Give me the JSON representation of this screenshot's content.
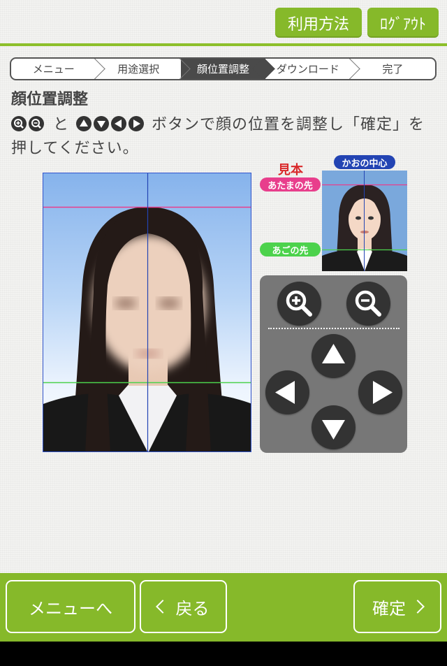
{
  "header": {
    "howto_label": "利用方法",
    "logout_label": "ﾛｸﾞｱｳﾄ"
  },
  "steps": [
    {
      "label": "メニュー",
      "active": false
    },
    {
      "label": "用途選択",
      "active": false
    },
    {
      "label": "顔位置調整",
      "active": true
    },
    {
      "label": "ダウンロード",
      "active": false
    },
    {
      "label": "完了",
      "active": false
    }
  ],
  "page": {
    "title": "顔位置調整",
    "instruction_and": "と",
    "instruction_rest": "ボタンで顔の位置を調整し「確定」を押してください。"
  },
  "sample": {
    "title": "見本",
    "center_label": "かおの中心",
    "head_label": "あたまの先",
    "chin_label": "あごの先"
  },
  "controls": {
    "zoom_in": "zoom-in-icon",
    "zoom_out": "zoom-out-icon",
    "up": "arrow-up-icon",
    "down": "arrow-down-icon",
    "left": "arrow-left-icon",
    "right": "arrow-right-icon"
  },
  "footer": {
    "menu_label": "メニューへ",
    "back_label": "戻る",
    "confirm_label": "確定"
  },
  "colors": {
    "accent_green": "#86b92a",
    "guide_pink": "#e83e8c",
    "guide_green": "#4cd24c",
    "guide_blue": "#2344b3",
    "sample_title_red": "#d9282a"
  }
}
